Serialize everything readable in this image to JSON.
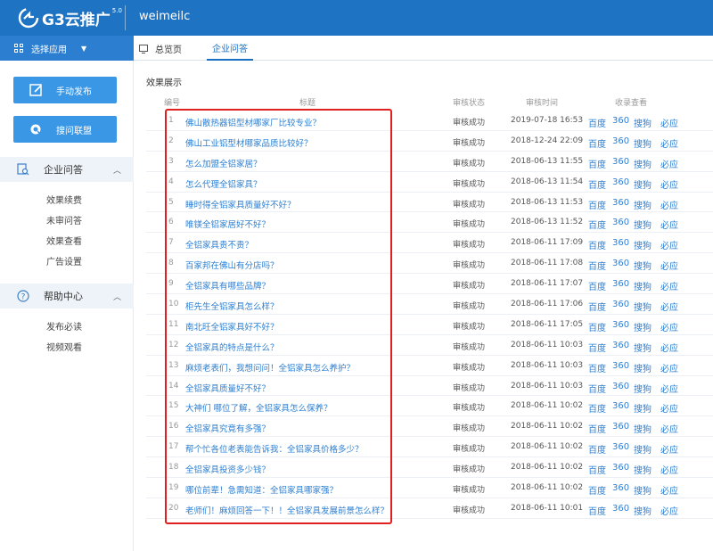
{
  "header": {
    "logo_text": "G3云推广",
    "logo_version": "5.0",
    "account": "weimeilc"
  },
  "app_switch": {
    "label": "选择应用"
  },
  "tabs": [
    {
      "label": "总览页"
    },
    {
      "label": "企业问答"
    }
  ],
  "sidebar": {
    "buttons": [
      {
        "label": "手动发布"
      },
      {
        "label": "搜问联盟"
      }
    ],
    "sections": [
      {
        "title": "企业问答",
        "items": [
          "效果续费",
          "未审问答",
          "效果查看",
          "广告设置"
        ]
      },
      {
        "title": "帮助中心",
        "items": [
          "发布必读",
          "视频观看"
        ]
      }
    ]
  },
  "main": {
    "section_title": "效果展示",
    "columns": [
      "编号",
      "标题",
      "审核状态",
      "审核时间",
      "收录查看"
    ],
    "engines": [
      "百度",
      "360",
      "搜狗",
      "必应"
    ],
    "rows": [
      {
        "num": "1",
        "title": "佛山散热器铝型材哪家厂比较专业？",
        "status": "审核成功",
        "time": "2019-07-18 16:53"
      },
      {
        "num": "2",
        "title": "佛山工业铝型材哪家品质比较好？",
        "status": "审核成功",
        "time": "2018-12-24 22:09"
      },
      {
        "num": "3",
        "title": "怎么加盟全铝家居？",
        "status": "审核成功",
        "time": "2018-06-13 11:55"
      },
      {
        "num": "4",
        "title": "怎么代理全铝家具？",
        "status": "审核成功",
        "time": "2018-06-13 11:54"
      },
      {
        "num": "5",
        "title": "睡时得全铝家具质量好不好？",
        "status": "审核成功",
        "time": "2018-06-13 11:53"
      },
      {
        "num": "6",
        "title": "唯镁全铝家居好不好？",
        "status": "审核成功",
        "time": "2018-06-13 11:52"
      },
      {
        "num": "7",
        "title": "全铝家具贵不贵？",
        "status": "审核成功",
        "time": "2018-06-11 17:09"
      },
      {
        "num": "8",
        "title": "百家邦在佛山有分店吗？",
        "status": "审核成功",
        "time": "2018-06-11 17:08"
      },
      {
        "num": "9",
        "title": "全铝家具有哪些品牌？",
        "status": "审核成功",
        "time": "2018-06-11 17:07"
      },
      {
        "num": "10",
        "title": "柜先生全铝家具怎么样？",
        "status": "审核成功",
        "time": "2018-06-11 17:06"
      },
      {
        "num": "11",
        "title": "南北旺全铝家具好不好？",
        "status": "审核成功",
        "time": "2018-06-11 17:05"
      },
      {
        "num": "12",
        "title": "全铝家具的特点是什么？",
        "status": "审核成功",
        "time": "2018-06-11 10:03"
      },
      {
        "num": "13",
        "title": "麻烦老表们，我想问问！全铝家具怎么养护？",
        "status": "审核成功",
        "time": "2018-06-11 10:03"
      },
      {
        "num": "14",
        "title": "全铝家具质量好不好？",
        "status": "审核成功",
        "time": "2018-06-11 10:03"
      },
      {
        "num": "15",
        "title": "大神们 哪位了解，全铝家具怎么保养？",
        "status": "审核成功",
        "time": "2018-06-11 10:02"
      },
      {
        "num": "16",
        "title": "全铝家具究竟有多强？",
        "status": "审核成功",
        "time": "2018-06-11 10:02"
      },
      {
        "num": "17",
        "title": "帮个忙各位老表能告诉我：全铝家具价格多少？",
        "status": "审核成功",
        "time": "2018-06-11 10:02"
      },
      {
        "num": "18",
        "title": "全铝家具投资多少钱？",
        "status": "审核成功",
        "time": "2018-06-11 10:02"
      },
      {
        "num": "19",
        "title": "哪位前辈！急需知道：全铝家具哪家强？",
        "status": "审核成功",
        "time": "2018-06-11 10:02"
      },
      {
        "num": "20",
        "title": "老师们！麻烦回答一下！！全铝家具发展前景怎么样？",
        "status": "审核成功",
        "time": "2018-06-11 10:01"
      }
    ]
  },
  "colors": {
    "header_bg": "#1f73c3",
    "button_bg": "#3a97e6",
    "link": "#2d7fd2",
    "highlight_box": "#e02020"
  }
}
